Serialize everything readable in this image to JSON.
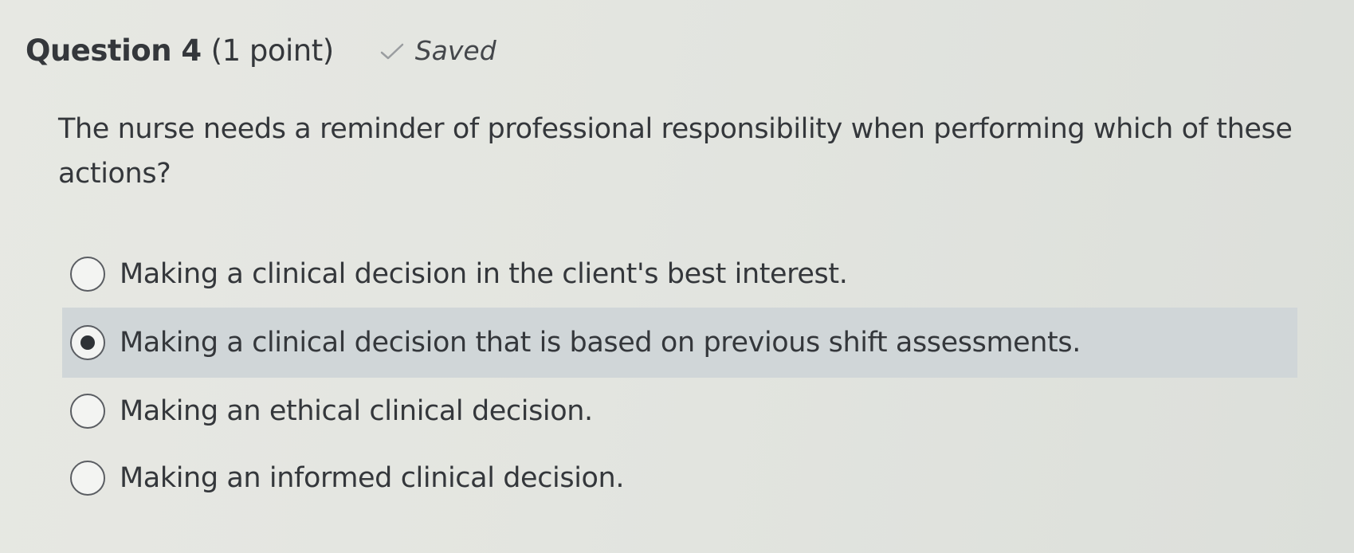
{
  "question": {
    "title": "Question 4",
    "points": "(1 point)",
    "status": "Saved",
    "status_icon": "checkmark-icon",
    "prompt": "The nurse needs a reminder of professional responsibility when performing which of these actions?"
  },
  "options": [
    {
      "label": "Making a clinical decision in the client's best interest.",
      "selected": false
    },
    {
      "label": "Making a clinical decision that is based on previous shift assessments.",
      "selected": true
    },
    {
      "label": "Making an ethical clinical decision.",
      "selected": false
    },
    {
      "label": "Making an informed clinical decision.",
      "selected": false
    }
  ],
  "colors": {
    "background": "#e3e5e0",
    "selected_row": "#d0d6d8",
    "text": "#34373b"
  }
}
